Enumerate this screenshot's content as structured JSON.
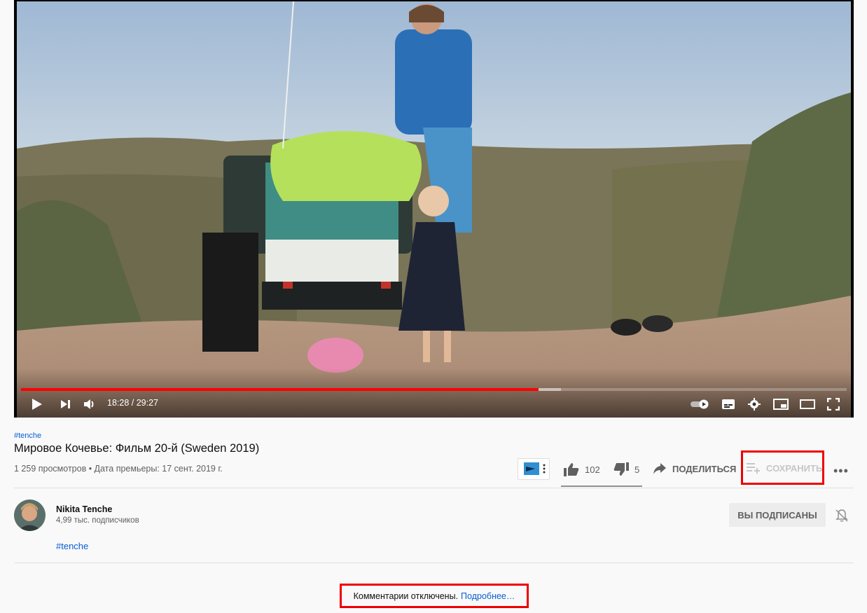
{
  "player": {
    "current_time": "18:28",
    "duration": "29:27",
    "time_display": "18:28 / 29:27",
    "progress_fraction": 0.627,
    "buffered_fraction": 0.654,
    "icons": [
      "play-icon",
      "next-icon",
      "volume-icon",
      "autoplay-toggle-icon",
      "subtitles-icon",
      "settings-icon",
      "miniplayer-icon",
      "theater-mode-icon",
      "fullscreen-icon"
    ]
  },
  "video": {
    "hashtag": "#tenche",
    "title": "Мировое Кочевье: Фильм 20-й (Sweden 2019)",
    "meta": "1 259 просмотров • Дата премьеры: 17 сент. 2019 г."
  },
  "actions": {
    "likes": "102",
    "dislikes": "5",
    "share_label": "ПОДЕЛИТЬСЯ",
    "save_label": "СОХРАНИТЬ",
    "more_label": "•••",
    "like_ratio": 0.953
  },
  "channel": {
    "name": "Nikita Tenche",
    "subscribers": "4,99 тыс. подписчиков",
    "subscribed_label": "ВЫ ПОДПИСАНЫ",
    "description_hashtag": "#tenche"
  },
  "comments": {
    "disabled_text": "Комментарии отключены.",
    "learn_more": "Подробнее…"
  },
  "colors": {
    "accent_red": "#ff0000",
    "link_blue": "#065fd4",
    "highlight_red": "#e00000"
  }
}
